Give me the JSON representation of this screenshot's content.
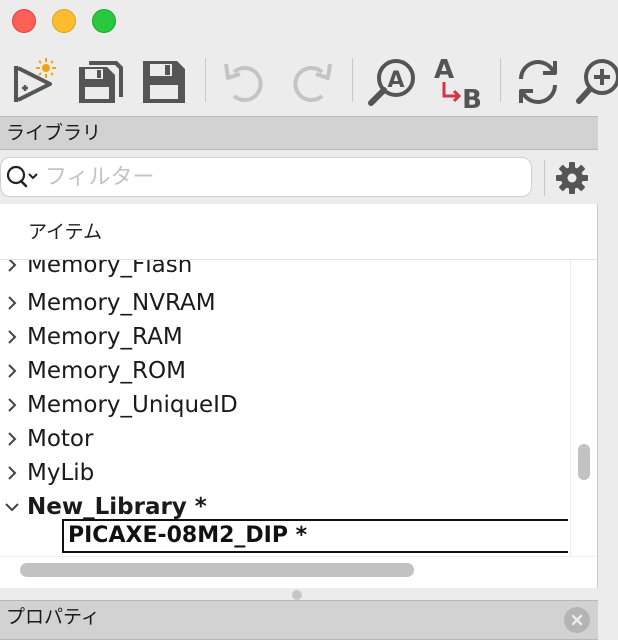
{
  "window": {
    "traffic_lights": [
      "close",
      "minimize",
      "maximize"
    ]
  },
  "toolbar": {
    "buttons": [
      {
        "icon": "new-symbol-sparkle-icon"
      },
      {
        "icon": "save-all-icon"
      },
      {
        "icon": "save-icon"
      },
      {
        "icon": "undo-icon"
      },
      {
        "icon": "redo-icon"
      },
      {
        "icon": "find-icon"
      },
      {
        "icon": "replace-icon"
      },
      {
        "icon": "refresh-icon"
      },
      {
        "icon": "zoom-in-icon"
      }
    ]
  },
  "library": {
    "title": "ライブラリ",
    "filter": {
      "value": "",
      "placeholder": "フィルター"
    },
    "column_header": "アイテム",
    "items": [
      {
        "label": "Memory_Flash",
        "expanded": false,
        "bold": false
      },
      {
        "label": "Memory_NVRAM",
        "expanded": false,
        "bold": false
      },
      {
        "label": "Memory_RAM",
        "expanded": false,
        "bold": false
      },
      {
        "label": "Memory_ROM",
        "expanded": false,
        "bold": false
      },
      {
        "label": "Memory_UniqueID",
        "expanded": false,
        "bold": false
      },
      {
        "label": "Motor",
        "expanded": false,
        "bold": false
      },
      {
        "label": "MyLib",
        "expanded": false,
        "bold": false
      },
      {
        "label": "New_Library *",
        "expanded": true,
        "bold": true
      }
    ],
    "child_item": "PICAXE-08M2_DIP *"
  },
  "properties": {
    "title": "プロパティ"
  },
  "colors": {
    "accent_red": "#d8334a",
    "panel_header": "#d2d2d2",
    "window_bg": "#ececec"
  }
}
